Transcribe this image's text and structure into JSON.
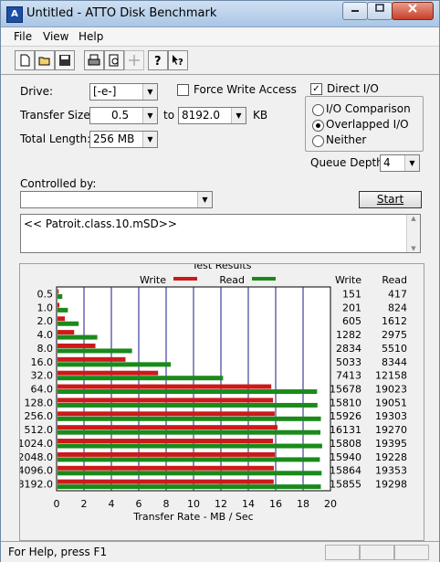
{
  "window": {
    "title": "Untitled - ATTO Disk Benchmark",
    "app_icon": "A"
  },
  "menu": {
    "file": "File",
    "view": "View",
    "help": "Help"
  },
  "toolbar": {
    "icons": [
      "new-icon",
      "open-icon",
      "save-icon",
      "print-icon",
      "print-preview-icon",
      "move-icon",
      "help-icon",
      "context-help-icon"
    ]
  },
  "settings": {
    "drive_label": "Drive:",
    "drive_value": "[-e-]",
    "transfer_size_label": "Transfer Size:",
    "transfer_from": "0.5",
    "to_label": "to",
    "transfer_to": "8192.0",
    "kb_label": "KB",
    "total_length_label": "Total Length:",
    "total_length_value": "256 MB",
    "force_write_label": "Force Write Access",
    "force_write_checked": false,
    "direct_io_label": "Direct I/O",
    "direct_io_checked": true,
    "io_comparison_label": "I/O Comparison",
    "overlapped_io_label": "Overlapped I/O",
    "neither_label": "Neither",
    "selected_io_mode": "Overlapped I/O",
    "queue_depth_label": "Queue Depth:",
    "queue_depth_value": "4",
    "controlled_by_label": "Controlled by:",
    "controlled_by_value": "",
    "start_label": "Start",
    "description": "<< Patroit.class.10.mSD>>"
  },
  "chart_data": {
    "type": "bar",
    "title": "Test Results",
    "xlabel": "Transfer Rate - MB / Sec",
    "xlim": [
      0,
      20
    ],
    "xticks": [
      "0",
      "2",
      "4",
      "6",
      "8",
      "10",
      "12",
      "14",
      "16",
      "18",
      "20"
    ],
    "legend": [
      "Write",
      "Read"
    ],
    "colors": {
      "write": "#cc1a1a",
      "read": "#1a8a1a"
    },
    "categories": [
      "0.5",
      "1.0",
      "2.0",
      "4.0",
      "8.0",
      "16.0",
      "32.0",
      "64.0",
      "128.0",
      "256.0",
      "512.0",
      "1024.0",
      "2048.0",
      "4096.0",
      "8192.0"
    ],
    "series": [
      {
        "name": "Write",
        "values": [
          151,
          201,
          605,
          1282,
          2834,
          5033,
          7413,
          15678,
          15810,
          15926,
          16131,
          15808,
          15940,
          15864,
          15855
        ]
      },
      {
        "name": "Read",
        "values": [
          417,
          824,
          1612,
          2975,
          5510,
          8344,
          12158,
          19023,
          19051,
          19303,
          19270,
          19395,
          19228,
          19353,
          19298
        ]
      }
    ],
    "col_write_header": "Write",
    "col_read_header": "Read"
  },
  "status": {
    "text": "For Help, press F1"
  }
}
